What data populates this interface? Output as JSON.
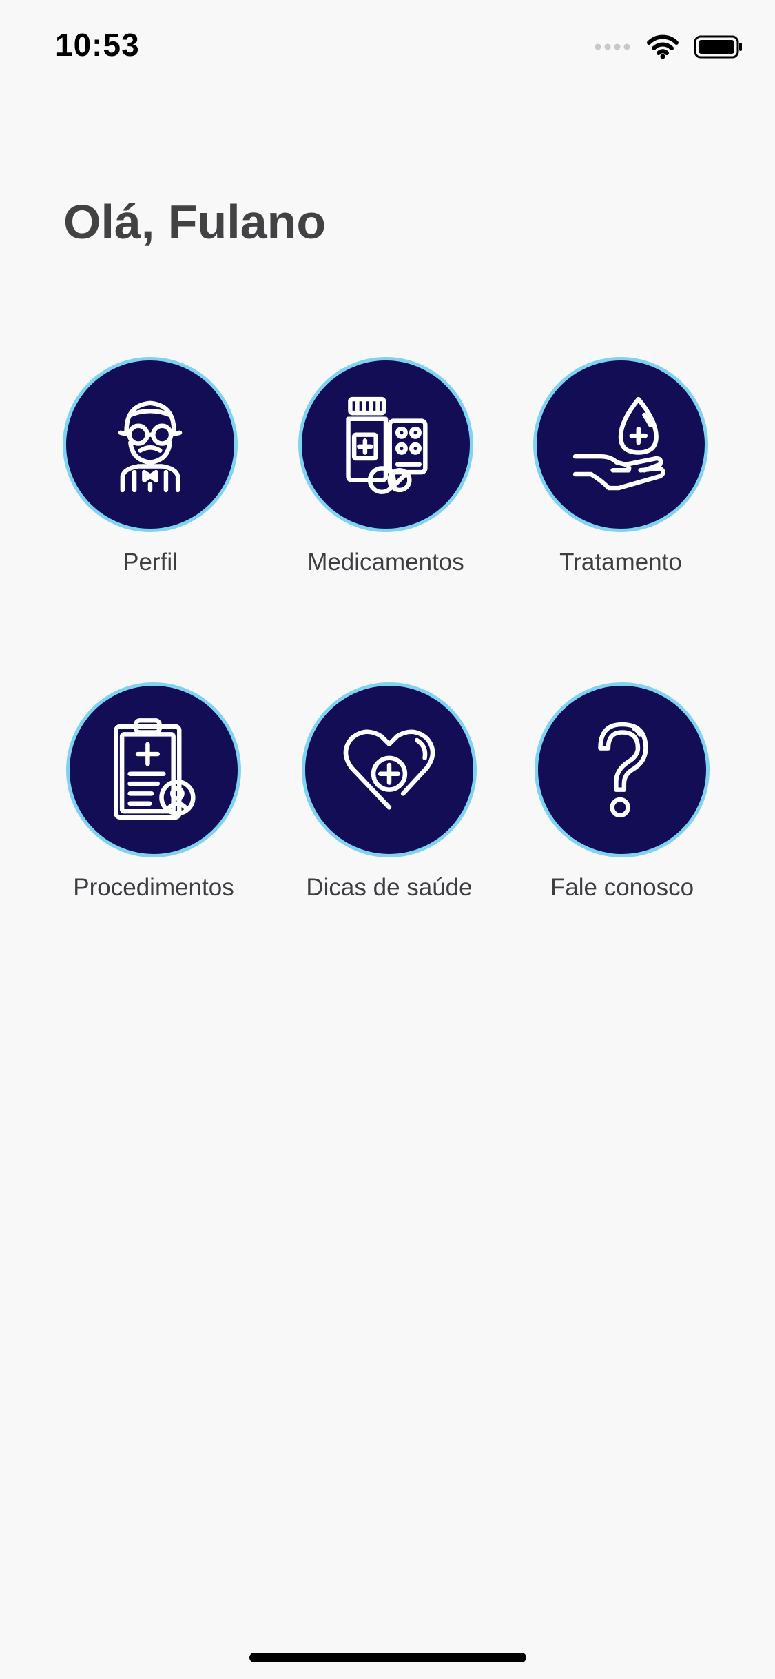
{
  "status_bar": {
    "time": "10:53",
    "icons": [
      "signal-dots-icon",
      "wifi-icon",
      "battery-icon"
    ]
  },
  "header": {
    "greeting": "Olá, Fulano"
  },
  "menu": {
    "items": [
      {
        "label": "Perfil",
        "icon": "elderly-man-icon"
      },
      {
        "label": "Medicamentos",
        "icon": "medicine-bottle-pills-icon"
      },
      {
        "label": "Tratamento",
        "icon": "hand-drop-icon"
      },
      {
        "label": "Procedimentos",
        "icon": "clipboard-medical-icon"
      },
      {
        "label": "Dicas de saúde",
        "icon": "heart-cross-icon"
      },
      {
        "label": "Fale conosco",
        "icon": "question-mark-icon"
      }
    ]
  },
  "colors": {
    "background": "#f8f8f9",
    "circle_fill": "#120d55",
    "circle_border": "#7fd3f2",
    "label_text": "#3e3e42",
    "greeting_text": "#424244"
  }
}
